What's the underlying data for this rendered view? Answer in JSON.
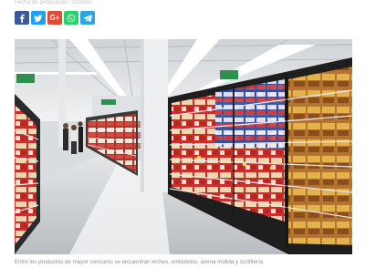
{
  "article": {
    "meta_text": "Fecha de publicación: Octubre",
    "caption": "Entre los productos de mayor consumo se encuentran leches, embutidos, avena molida y confitería"
  },
  "share": [
    {
      "id": "facebook",
      "icon": "facebook-icon",
      "color": "#3b5998"
    },
    {
      "id": "twitter",
      "icon": "twitter-icon",
      "color": "#1da1f2"
    },
    {
      "id": "googleplus",
      "icon": "google-plus-icon",
      "color": "#dd4b39",
      "glyph": "G+"
    },
    {
      "id": "whatsapp",
      "icon": "whatsapp-icon",
      "color": "#25d366"
    },
    {
      "id": "telegram",
      "icon": "telegram-icon",
      "color": "#2ca5e0"
    }
  ],
  "photo": {
    "subject": "supermarket-aisle-image",
    "colors": {
      "ceiling": "#e4e7ea",
      "floor": "#c9ccd0",
      "shelf_frame": "#2a2a2a",
      "sign": "#2f8f4e"
    }
  }
}
